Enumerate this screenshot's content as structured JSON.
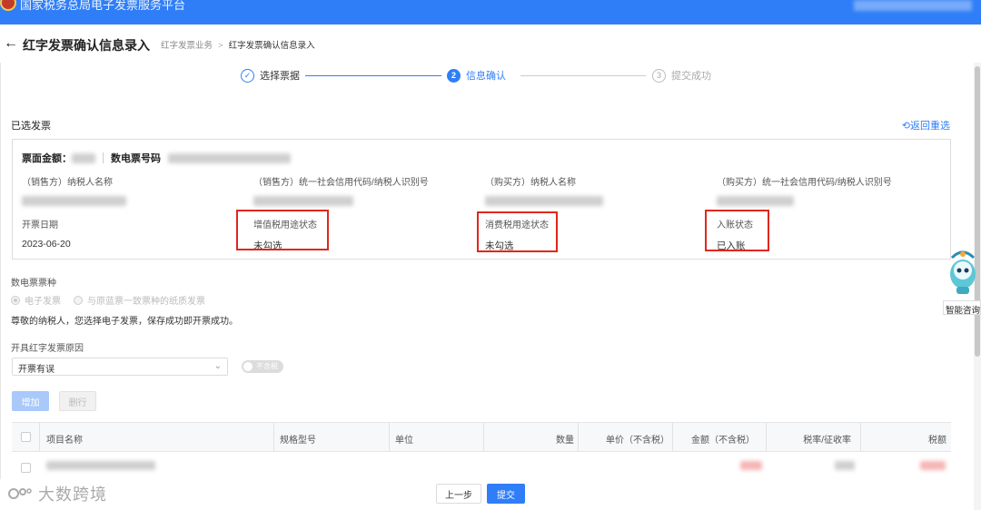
{
  "header": {
    "site_title": "国家税务总局电子发票服务平台"
  },
  "page": {
    "title": "红字发票确认信息录入",
    "breadcrumb": [
      "红字发票业务",
      "红字发票确认信息录入"
    ]
  },
  "steps": [
    {
      "index": "✓",
      "label": "选择票据",
      "state": "done"
    },
    {
      "index": "2",
      "label": "信息确认",
      "state": "active"
    },
    {
      "index": "3",
      "label": "提交成功",
      "state": "todo"
    }
  ],
  "selected_invoice": {
    "section_title": "已选发票",
    "reselect_label": "返回重选",
    "amount_label": "票面金额：",
    "number_label": "数电票号码",
    "seller_name_label": "（销售方）纳税人名称",
    "seller_id_label": "（销售方）统一社会信用代码/纳税人识别号",
    "buyer_name_label": "（购买方）纳税人名称",
    "buyer_id_label": "（购买方）统一社会信用代码/纳税人识别号",
    "issue_date_label": "开票日期",
    "issue_date": "2023-06-20",
    "vat_use_label": "增值税用途状态",
    "vat_use": "未勾选",
    "consumption_use_label": "消费税用途状态",
    "consumption_use": "未勾选",
    "accounting_label": "入账状态",
    "accounting": "已入账"
  },
  "invoice_type": {
    "label": "数电票票种",
    "options": [
      "电子发票",
      "与原蓝票一致票种的纸质发票"
    ],
    "notice": "尊敬的纳税人，您选择电子发票，保存成功即开票成功。"
  },
  "reason": {
    "label": "开具红字发票原因",
    "value": "开票有误",
    "toggle_label": "不含税"
  },
  "buttons": {
    "add": "增加",
    "delete": "删行",
    "prev": "上一步",
    "submit": "提交"
  },
  "table": {
    "columns": [
      "项目名称",
      "规格型号",
      "单位",
      "数量",
      "单价（不含税）",
      "金额（不含税）",
      "税率/征收率",
      "税额"
    ]
  },
  "assistant": {
    "label": "智能咨询"
  },
  "watermark": "大数跨境",
  "colors": {
    "primary": "#2f7ef7",
    "highlight_box": "#e0271b"
  }
}
